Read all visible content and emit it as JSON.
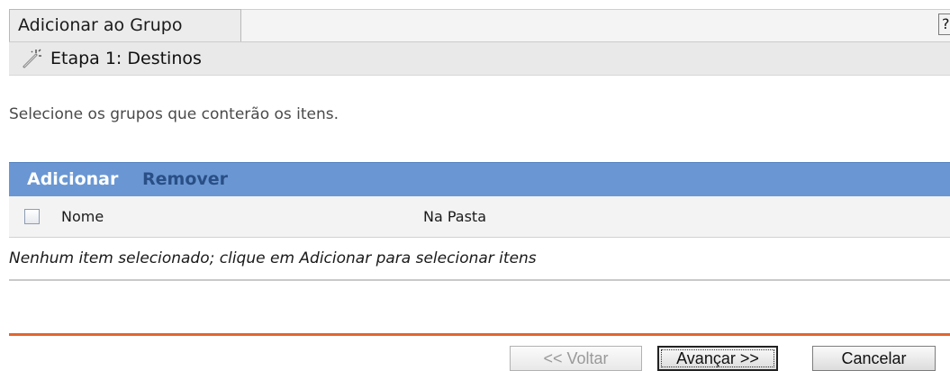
{
  "header": {
    "title": "Adicionar ao Grupo",
    "help_label": "?",
    "step_icon": "wizard-wand-icon",
    "step_label": "Etapa 1: Destinos"
  },
  "main": {
    "instruction": "Selecione os grupos que conterão os itens."
  },
  "table": {
    "toolbar": {
      "add_label": "Adicionar",
      "remove_label": "Remover"
    },
    "columns": [
      "Nome",
      "Na Pasta"
    ],
    "select_all_checked": false,
    "empty_message": "Nenhum item selecionado; clique em Adicionar para selecionar itens"
  },
  "footer": {
    "back_label": "<< Voltar",
    "back_enabled": false,
    "next_label": "Avançar >>",
    "cancel_label": "Cancelar"
  },
  "colors": {
    "toolbar_blue": "#6a97d3",
    "remove_link": "#2a4f86",
    "footer_rule": "#e2652e"
  }
}
